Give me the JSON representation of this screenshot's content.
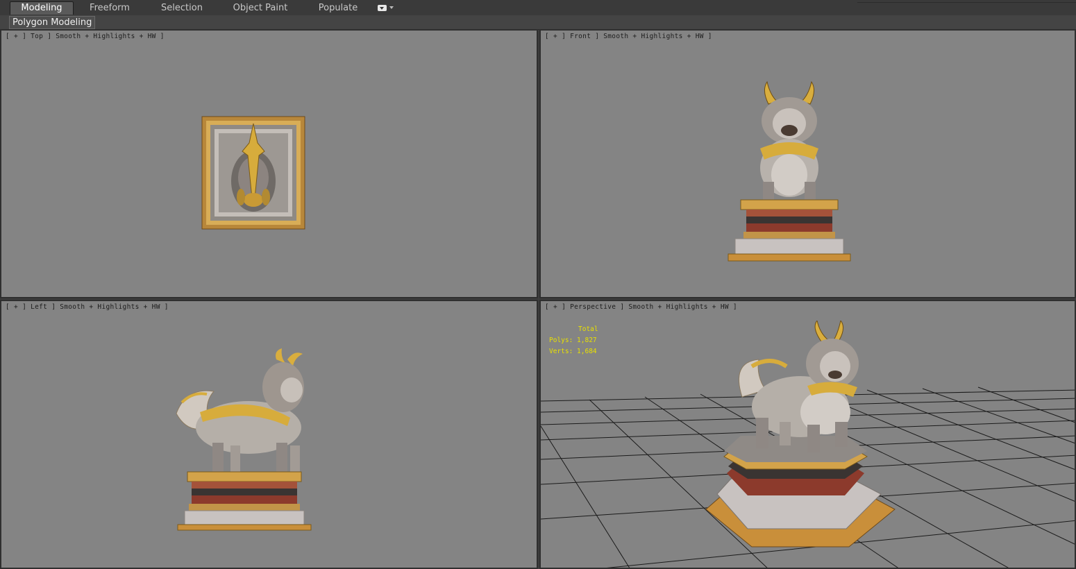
{
  "ribbon": {
    "tabs": [
      "Modeling",
      "Freeform",
      "Selection",
      "Object Paint",
      "Populate"
    ],
    "active_tab": "Modeling"
  },
  "subbar": {
    "panel_label": "Polygon Modeling"
  },
  "viewports": {
    "top": {
      "label": "[ + ] Top ] Smooth + Highlights + HW ]"
    },
    "front": {
      "label": "[ + ] Front ] Smooth + Highlights + HW ]"
    },
    "left": {
      "label": "[ + ] Left ] Smooth + Highlights + HW ]"
    },
    "perspective": {
      "label": "[ + ] Perspective ] Smooth + Highlights + HW ]",
      "stats": {
        "title": "Total",
        "polys": "Polys: 1,827",
        "verts": "Verts: 1,684"
      }
    }
  },
  "colors": {
    "viewport_bg": "#848484",
    "gold": "#c9a33e",
    "stone": "#b8b2ac",
    "stats_text": "#e8e000"
  }
}
